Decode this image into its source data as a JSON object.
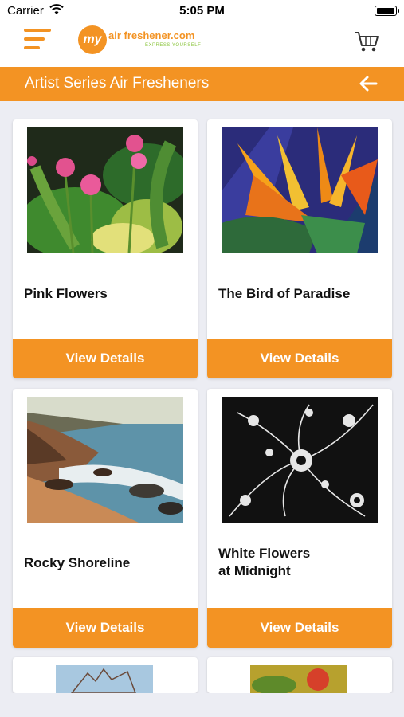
{
  "status_bar": {
    "carrier": "Carrier",
    "time": "5:05 PM"
  },
  "header": {
    "logo_prefix": "my",
    "logo_name": "air freshener.com",
    "logo_tagline": "EXPRESS YOURSELF"
  },
  "titlebar": {
    "title": "Artist Series Air Fresheners"
  },
  "products": [
    {
      "title": "Pink Flowers",
      "button": "View Details"
    },
    {
      "title": "The Bird of Paradise",
      "button": "View Details"
    },
    {
      "title": "Rocky Shoreline",
      "button": "View Details"
    },
    {
      "title": "White Flowers at Midnight",
      "button": "View Details"
    }
  ],
  "colors": {
    "accent": "#f39323",
    "background": "#ecedf3"
  }
}
